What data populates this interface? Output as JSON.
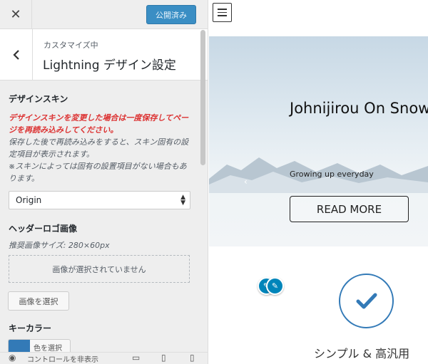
{
  "topbar": {
    "close_label": "✕",
    "publish_label": "公開済み"
  },
  "section": {
    "subtitle": "カスタマイズ中",
    "title": "Lightning デザイン設定",
    "back_label": "‹"
  },
  "design_skin": {
    "label": "デザインスキン",
    "warning": "デザインスキンを変更した場合は一度保存してページを再読み込みしてください。",
    "desc1": "保存した後で再読み込みをすると、スキン固有の設定項目が表示されます。",
    "desc2": "※スキンによっては固有の設置項目がない場合もあります。",
    "selected": "Origin"
  },
  "header_logo": {
    "label": "ヘッダーロゴ画像",
    "desc": "推奨画像サイズ: 280×60px",
    "placeholder": "画像が選択されていません",
    "select_button": "画像を選択"
  },
  "key_color": {
    "label": "キーカラー",
    "button": "色を選択",
    "color": "#337ab7"
  },
  "footer": {
    "hide_controls": "コントロールを非表示"
  },
  "preview": {
    "hero_title": "Johnijirou On Snow",
    "hero_subtitle": "Growing up everyday",
    "read_more": "READ MORE",
    "feature_title": "シンプル & 高汎用",
    "accent": "#337ab7"
  }
}
